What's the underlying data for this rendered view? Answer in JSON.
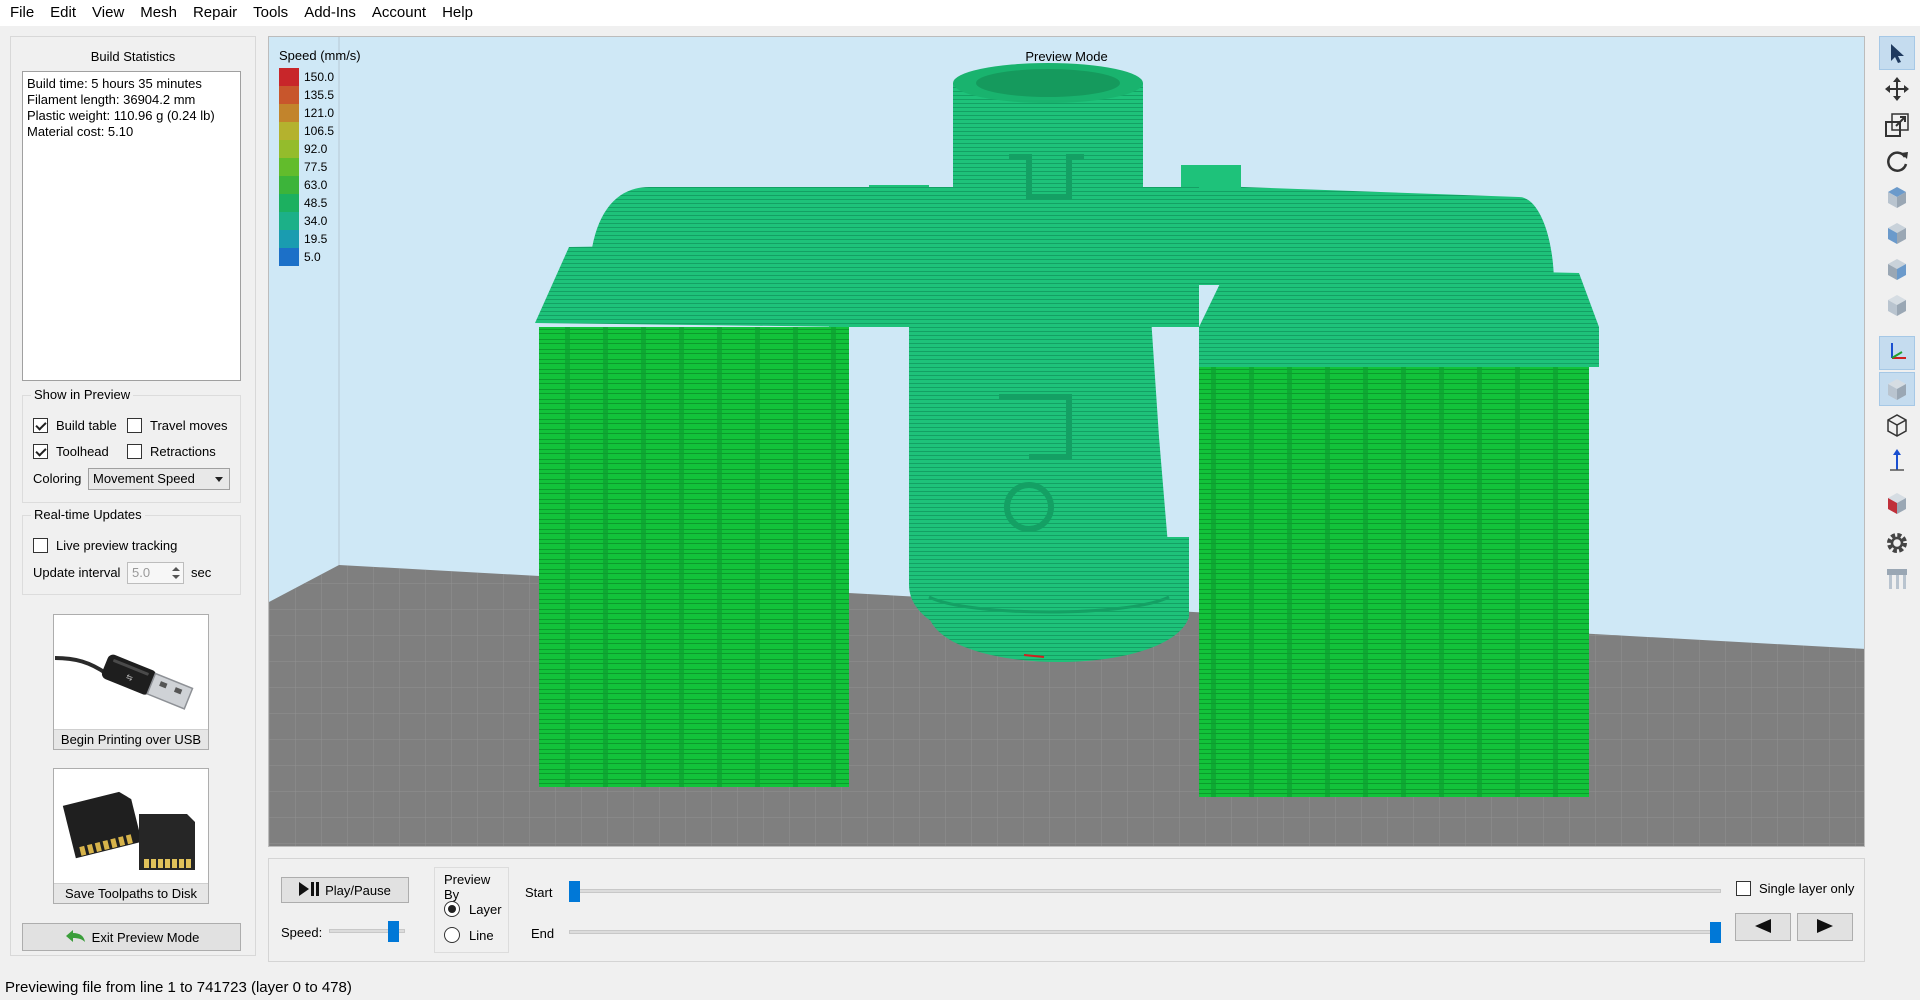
{
  "menu": [
    "File",
    "Edit",
    "View",
    "Mesh",
    "Repair",
    "Tools",
    "Add-Ins",
    "Account",
    "Help"
  ],
  "build_statistics": {
    "title": "Build Statistics",
    "lines": [
      "Build time: 5 hours 35 minutes",
      "Filament length: 36904.2 mm",
      "Plastic weight: 110.96 g (0.24 lb)",
      "Material cost: 5.10"
    ]
  },
  "show_in_preview": {
    "title": "Show in Preview",
    "build_table": {
      "label": "Build table",
      "checked": true
    },
    "travel_moves": {
      "label": "Travel moves",
      "checked": false
    },
    "toolhead": {
      "label": "Toolhead",
      "checked": true
    },
    "retractions": {
      "label": "Retractions",
      "checked": false
    },
    "coloring_label": "Coloring",
    "coloring_value": "Movement Speed"
  },
  "realtime": {
    "title": "Real-time Updates",
    "live_tracking": {
      "label": "Live preview tracking",
      "checked": false
    },
    "interval_label": "Update interval",
    "interval_value": "5.0",
    "interval_unit": "sec"
  },
  "buttons": {
    "usb": "Begin Printing over USB",
    "disk": "Save Toolpaths to Disk",
    "exit": "Exit Preview Mode"
  },
  "viewport": {
    "title": "Preview Mode",
    "legend_title": "Speed (mm/s)",
    "legend": [
      {
        "value": "150.0",
        "color": "#c8262a"
      },
      {
        "value": "135.5",
        "color": "#c8562c"
      },
      {
        "value": "121.0",
        "color": "#c2842c"
      },
      {
        "value": "106.5",
        "color": "#b4b22e"
      },
      {
        "value": "92.0",
        "color": "#94bc2c"
      },
      {
        "value": "77.5",
        "color": "#62bc2c"
      },
      {
        "value": "63.0",
        "color": "#3cb43a"
      },
      {
        "value": "48.5",
        "color": "#1cb060"
      },
      {
        "value": "34.0",
        "color": "#1cb088"
      },
      {
        "value": "19.5",
        "color": "#1a9cb0"
      },
      {
        "value": "5.0",
        "color": "#1c70c8"
      }
    ]
  },
  "controls": {
    "play_pause": "Play/Pause",
    "speed_label": "Speed:",
    "speed_level": 0.9,
    "preview_by_title": "Preview By",
    "preview_by_layer": {
      "label": "Layer",
      "selected": true
    },
    "preview_by_line": {
      "label": "Line",
      "selected": false
    },
    "start_label": "Start",
    "end_label": "End",
    "start_level": 0.0,
    "end_level": 1.0,
    "single_layer": {
      "label": "Single layer only",
      "checked": false
    }
  },
  "toolbar_icons": [
    "select-arrow-icon",
    "move-icon",
    "scale-icon",
    "rotate-icon",
    "view-top-cube-icon",
    "view-front-cube-icon",
    "view-side-cube-icon",
    "view-iso-cube-icon",
    "axes-icon",
    "solid-cube-icon",
    "wireframe-cube-icon",
    "z-axis-icon",
    "cross-section-icon",
    "gear-icon",
    "supports-icon"
  ],
  "status": "Previewing file from line 1 to 741723 (layer 0 to 478)"
}
